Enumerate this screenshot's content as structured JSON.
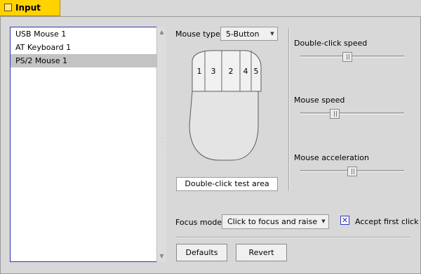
{
  "window": {
    "title": "Input",
    "close_icon": "close-box-icon"
  },
  "devices": {
    "items": [
      {
        "label": "USB Mouse 1",
        "selected": false
      },
      {
        "label": "AT Keyboard 1",
        "selected": false
      },
      {
        "label": "PS/2 Mouse 1",
        "selected": true
      }
    ]
  },
  "mouse_type": {
    "label": "Mouse type:",
    "value": "5-Button"
  },
  "mouse_buttons": [
    "1",
    "3",
    "2",
    "4",
    "5"
  ],
  "double_click_test": {
    "label": "Double-click test area"
  },
  "sliders": {
    "double_click_speed": {
      "label": "Double-click speed",
      "level": 0.45
    },
    "mouse_speed": {
      "label": "Mouse speed",
      "level": 0.33
    },
    "mouse_acceleration": {
      "label": "Mouse acceleration",
      "level": 0.5
    }
  },
  "focus_mode": {
    "label": "Focus mode:",
    "value": "Click to focus and raise"
  },
  "accept_first_click": {
    "label": "Accept first click",
    "checked": true,
    "mark": "✕"
  },
  "buttons": {
    "defaults": "Defaults",
    "revert": "Revert"
  },
  "colors": {
    "title_tab": "#ffd200",
    "accent": "#2d38b4",
    "selection": "#c3c3c3"
  }
}
